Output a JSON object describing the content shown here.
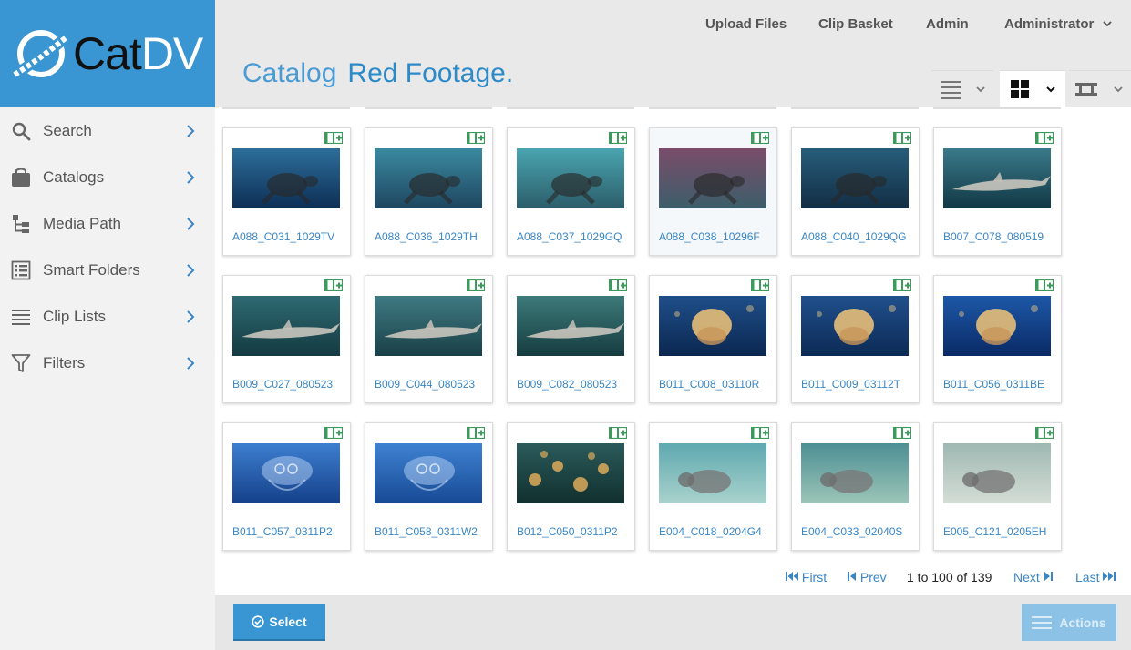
{
  "brand": {
    "name_part1": "Cat",
    "name_part2": "DV"
  },
  "topnav": {
    "upload": "Upload Files",
    "basket": "Clip Basket",
    "admin": "Admin",
    "user": "Administrator"
  },
  "title": {
    "prefix": "Catalog",
    "name": "Red Footage",
    "dot": "."
  },
  "sidebar": {
    "items": [
      {
        "label": "Search",
        "icon": "search-icon"
      },
      {
        "label": "Catalogs",
        "icon": "catalog-icon"
      },
      {
        "label": "Media Path",
        "icon": "tree-icon"
      },
      {
        "label": "Smart Folders",
        "icon": "smart-folder-icon"
      },
      {
        "label": "Clip Lists",
        "icon": "list-icon"
      },
      {
        "label": "Filters",
        "icon": "filter-icon"
      }
    ]
  },
  "clips": [
    {
      "name": "A088_C031_1029TV",
      "c1": "#2d6e9b",
      "c2": "#0d2f55",
      "subject": "turtle"
    },
    {
      "name": "A088_C036_1029TH",
      "c1": "#3a8aa0",
      "c2": "#1f4660",
      "subject": "turtle"
    },
    {
      "name": "A088_C037_1029GQ",
      "c1": "#49a5b0",
      "c2": "#2c5d6a",
      "subject": "turtle"
    },
    {
      "name": "A088_C038_10296F",
      "c1": "#7a4c6a",
      "c2": "#3c5e6a",
      "subject": "turtle"
    },
    {
      "name": "A088_C040_1029QG",
      "c1": "#275d7a",
      "c2": "#132e45",
      "subject": "turtle"
    },
    {
      "name": "B007_C078_080519",
      "c1": "#3a7a8a",
      "c2": "#123845",
      "subject": "shark"
    },
    {
      "name": "B009_C027_080523",
      "c1": "#2f6a72",
      "c2": "#143a42",
      "subject": "shark"
    },
    {
      "name": "B009_C044_080523",
      "c1": "#3f7a82",
      "c2": "#1a4048",
      "subject": "shark"
    },
    {
      "name": "B009_C082_080523",
      "c1": "#3d7a7a",
      "c2": "#163c40",
      "subject": "shark"
    },
    {
      "name": "B011_C008_03110R",
      "c1": "#1f4f8a",
      "c2": "#0b2750",
      "subject": "jelly"
    },
    {
      "name": "B011_C009_03112T",
      "c1": "#20508c",
      "c2": "#0c2a55",
      "subject": "jelly"
    },
    {
      "name": "B011_C056_0311BE",
      "c1": "#1d58a8",
      "c2": "#0a2a66",
      "subject": "jelly"
    },
    {
      "name": "B011_C057_0311P2",
      "c1": "#3d7fcf",
      "c2": "#15408a",
      "subject": "moonjelly"
    },
    {
      "name": "B011_C058_0311W2",
      "c1": "#3f82d2",
      "c2": "#174a95",
      "subject": "moonjelly"
    },
    {
      "name": "B012_C050_0311P2",
      "c1": "#2b5a5a",
      "c2": "#10302e",
      "subject": "jellies"
    },
    {
      "name": "E004_C018_0204G4",
      "c1": "#5fa9b0",
      "c2": "#a9d2cc",
      "subject": "manatee"
    },
    {
      "name": "E004_C033_02040S",
      "c1": "#4d8f94",
      "c2": "#9cc5b8",
      "subject": "manatee"
    },
    {
      "name": "E005_C121_0205EH",
      "c1": "#9fb8b2",
      "c2": "#d4ddd6",
      "subject": "manatee"
    }
  ],
  "pager": {
    "first": "First",
    "prev": "Prev",
    "status": "1 to 100 of 139",
    "next": "Next",
    "last": "Last"
  },
  "bottom": {
    "select": "Select",
    "actions": "Actions"
  },
  "colors": {
    "brand": "#3a96d2",
    "link": "#3a86c4",
    "badge": "#3e9a5c"
  }
}
